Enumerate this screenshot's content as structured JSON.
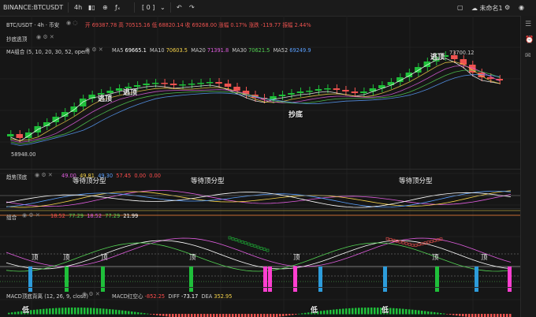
{
  "toolbar": {
    "symbol": "BINANCE:BTCUSDT",
    "bar_icon": "candles-icon",
    "indicators_icon": "fx-icon",
    "layout_label": "[ 0 ]",
    "layout_name": "未命名1",
    "right_icons": [
      "save-icon",
      "settings-icon",
      "camera-icon"
    ]
  },
  "legend": {
    "title": "BTC/USDT · 4h · 币安",
    "open_label": "开",
    "open": "69387.78",
    "high_label": "高",
    "high": "70515.16",
    "low_label": "低",
    "low": "68820.14",
    "close_label": "收",
    "close": "69268.00",
    "change_label": "涨幅",
    "change": "0.17%",
    "diff_label": "涨跌",
    "diff": "-119.77",
    "amp_label": "振幅",
    "amp": "2.44%"
  },
  "indicators": {
    "bottom_fishing": "抄底逃顶",
    "ma": {
      "name": "MA组合 (5, 10, 20, 30, 52, open)",
      "values": [
        {
          "label": "MA5",
          "value": "69665.1",
          "color": "#ffffff"
        },
        {
          "label": "MA10",
          "value": "70603.5",
          "color": "#f6d34a"
        },
        {
          "label": "MA20",
          "value": "71391.8",
          "color": "#e15ee0"
        },
        {
          "label": "MA30",
          "value": "70621.5",
          "color": "#54d454"
        },
        {
          "label": "MA52",
          "value": "69249.9",
          "color": "#5aa0ff"
        }
      ]
    },
    "trend": {
      "name": "趋势顶底",
      "values": [
        {
          "value": "49.00",
          "color": "#e15ee0"
        },
        {
          "value": "49.81",
          "color": "#f6d34a"
        },
        {
          "value": "49.30",
          "color": "#5aa0ff"
        },
        {
          "value": "57.45",
          "color": "#ff4d4d"
        },
        {
          "value": "0.00",
          "color": "#ff4d4d"
        },
        {
          "value": "0.00",
          "color": "#ff4d4d"
        }
      ]
    },
    "combo": {
      "name": "组合",
      "values": [
        {
          "value": "18.52",
          "color": "#ff4d4d"
        },
        {
          "value": "77.29",
          "color": "#54d454"
        },
        {
          "value": "18.52",
          "color": "#e15ee0"
        },
        {
          "value": "77.29",
          "color": "#54d454"
        },
        {
          "value": "21.99",
          "color": "#ffffff"
        }
      ]
    },
    "macd": {
      "name": "MACD顶底背离 (12, 26, 9, close)",
      "macd_label": "MACD红空心",
      "macd": "-852.25",
      "dif_label": "DIFF",
      "dif": "-73.17",
      "dea_label": "DEA",
      "dea": "352.95"
    }
  },
  "price_labels": {
    "high": "73700.12",
    "low": "58948.00"
  },
  "annotations": {
    "top1": "逃顶",
    "top2": "逃顶",
    "top3": "逃顶",
    "bottom": "抄底",
    "wait1": "等待顶分型",
    "wait2": "等待顶分型",
    "wait3": "等待顶分型",
    "ding": "顶",
    "di": "低",
    "small_top": "顶"
  },
  "colors": {
    "up": "#26a69a",
    "up_bright": "#1fbf3a",
    "down": "#ef5350",
    "bg": "#161616"
  }
}
